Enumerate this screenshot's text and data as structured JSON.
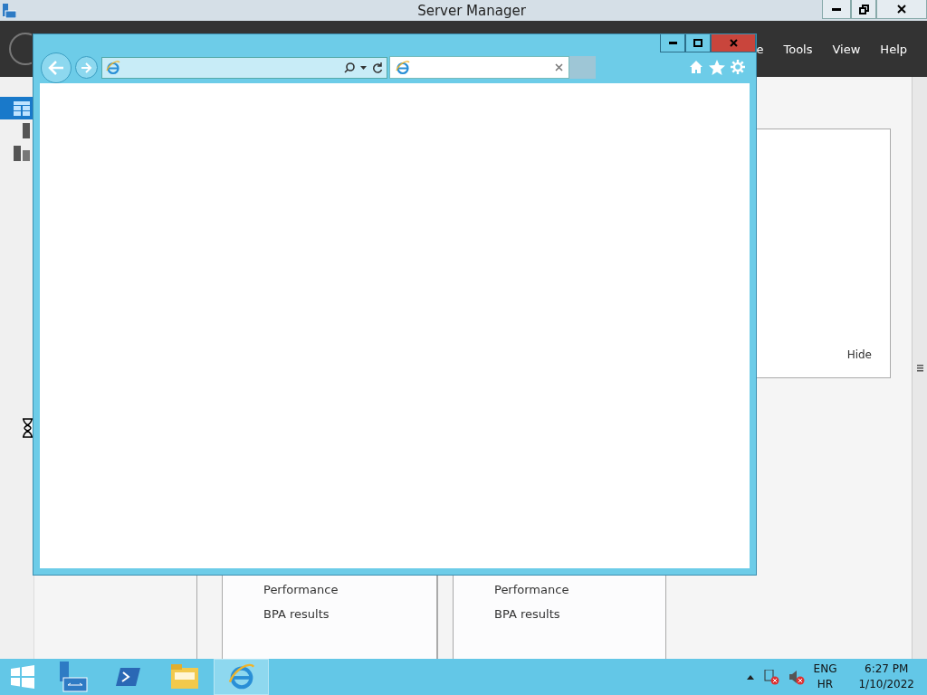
{
  "server_manager": {
    "title": "Server Manager",
    "menu": [
      {
        "label": "e"
      },
      {
        "label": "Tools"
      },
      {
        "label": "View"
      },
      {
        "label": "Help"
      }
    ],
    "nav": [
      {
        "kind": "dashboard",
        "selected": true
      },
      {
        "kind": "local",
        "selected": false
      },
      {
        "kind": "all",
        "selected": false
      }
    ],
    "welcome": {
      "hide": "Hide"
    },
    "tiles": [
      {
        "items": [
          "Performance",
          "BPA results"
        ]
      },
      {
        "items": [
          "Performance",
          "BPA results"
        ]
      }
    ]
  },
  "taskbar": {
    "apps": [
      {
        "kind": "server-manager",
        "selected": false
      },
      {
        "kind": "powershell",
        "selected": false
      },
      {
        "kind": "explorer",
        "selected": false
      },
      {
        "kind": "browser",
        "selected": true
      }
    ],
    "language": "ENG",
    "layout": "HR",
    "time": "6:27 PM",
    "date": "1/10/2022"
  }
}
